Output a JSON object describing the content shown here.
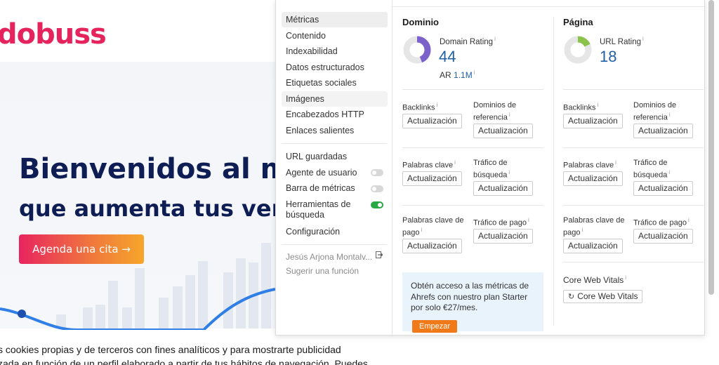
{
  "site": {
    "logo": "dobuss",
    "hero_title": "Bienvenidos al m",
    "hero_subtitle": "que aumenta tus ver",
    "cta_label": "Agenda una cita →",
    "cookie_line1": "s cookies propias y de terceros con fines analíticos y para mostrarte publicidad",
    "cookie_line2": "zada en función de un perfil elaborado a partir de tus hábitos de navegación. Puedes",
    "brand_color": "#e5245e",
    "title_color": "#0e1e55"
  },
  "menu": {
    "items": [
      {
        "label": "Métricas"
      },
      {
        "label": "Contenido"
      },
      {
        "label": "Indexabilidad"
      },
      {
        "label": "Datos estructurados"
      },
      {
        "label": "Etiquetas sociales"
      },
      {
        "label": "Imágenes"
      },
      {
        "label": "Encabezados HTTP"
      },
      {
        "label": "Enlaces salientes"
      }
    ],
    "saved_urls": "URL guardadas",
    "user_agent": "Agente de usuario",
    "metrics_bar": "Barra de métricas",
    "search_tools": "Herramientas de búsqueda",
    "settings": "Configuración",
    "user_name": "Jesús Arjona Montalv...",
    "suggest": "Sugerir una función",
    "toggles": {
      "user_agent": false,
      "metrics_bar": false,
      "search_tools": true
    }
  },
  "domain": {
    "title": "Dominio",
    "rating_label": "Domain Rating",
    "rating_value": "44",
    "rating_fraction": 0.44,
    "ar_label": "AR",
    "ar_value": "1.1M",
    "backlinks": "Backlinks",
    "ref_domains_1": "Dominios de",
    "ref_domains_2": "referencia",
    "keywords": "Palabras clave",
    "traffic_1": "Tráfico de",
    "traffic_2": "búsqueda",
    "paid_kw_1": "Palabras clave de",
    "paid_kw_2": "pago",
    "paid_traffic": "Tráfico de pago",
    "update": "Actualización",
    "promo_text": "Obtén acceso a las métricas de Ahrefs con nuestro plan Starter por solo €27/mes.",
    "promo_button": "Empezar",
    "ring_color": "#7b61c9"
  },
  "page": {
    "title": "Página",
    "rating_label": "URL Rating",
    "rating_value": "18",
    "rating_fraction": 0.18,
    "backlinks": "Backlinks",
    "ref_domains_1": "Dominios de",
    "ref_domains_2": "referencia",
    "keywords": "Palabras clave",
    "traffic_1": "Tráfico de",
    "traffic_2": "búsqueda",
    "paid_kw_1": "Palabras clave de",
    "paid_kw_2": "pago",
    "paid_traffic": "Tráfico de pago",
    "update": "Actualización",
    "cwv_label": "Core Web Vitals",
    "cwv_button": "Core Web Vitals",
    "ring_color": "#8bc34a"
  },
  "info_mark": "i"
}
